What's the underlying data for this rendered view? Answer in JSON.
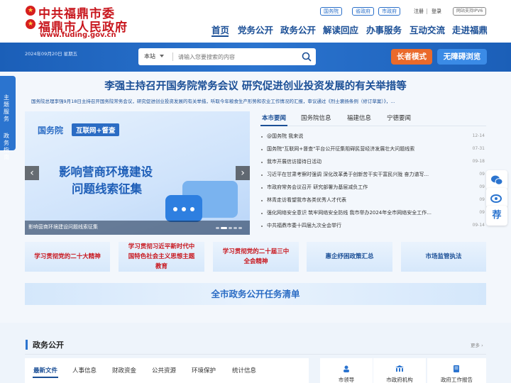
{
  "header": {
    "logo_line1": "中共福鼎市委",
    "logo_line2": "福鼎市人民政府",
    "logo_url": "www.fuding.gov.cn",
    "top_links": [
      "国务院",
      "省政府",
      "市政府"
    ],
    "register": "注册",
    "login": "登录",
    "ipv6": "网站支持IPV6"
  },
  "nav": [
    "首页",
    "党务公开",
    "政务公开",
    "解读回应",
    "办事服务",
    "互动交流",
    "走进福鼎"
  ],
  "band": {
    "date": "2024年09月20日 星期五",
    "search_scope": "本站",
    "search_placeholder": "请输入您要搜索的内容",
    "elder_mode": "长者模式",
    "accessible": "无障碍浏览"
  },
  "side_tab": {
    "item1": "主题服务",
    "item2": "政务指南"
  },
  "float_icons": [
    "wechat-icon",
    "weibo-icon",
    "recommend-icon"
  ],
  "float_recommend": "荐",
  "headline": {
    "title": "李强主持召开国务院常务会议 研究促进创业投资发展的有关举措等",
    "summary": "国务院总理李强9月18日主持召开国务院常务会议，研究促进创业投资发展的有关举措，听取今年粮食生产形势和农业工作情况的汇报，审议通过《烈士褒扬条例（修订草案）》，..."
  },
  "carousel": {
    "tag1": "国务院",
    "tag2": "互联网+督查",
    "title_line1": "影响营商环境建设",
    "title_line2": "问题线索征集",
    "caption": "影响营商环境建设问题线索征集",
    "prev": "‹",
    "next": "›"
  },
  "news": {
    "tabs": [
      "本市要闻",
      "国务院信息",
      "福建信息",
      "宁德要闻"
    ],
    "items": [
      {
        "title": "@国务院 我来说",
        "date": "12-14"
      },
      {
        "title": "国务院\"互联网+督查\"平台公开征集阻碍民营经济发展壮大问题线索",
        "date": "07-31"
      },
      {
        "title": "我市开展信访接待日活动",
        "date": "09-18"
      },
      {
        "title": "习近平在甘肃考察时强调 深化改革勇于创新苦干实干富民兴陇 奋力谱写...",
        "date": "09"
      },
      {
        "title": "市政府常务会议召开 研究部署为基层减负工作",
        "date": "09"
      },
      {
        "title": "林青走访看望我市各类优秀人才代表",
        "date": "09"
      },
      {
        "title": "强化网络安全意识 筑牢网络安全防线 我市举办2024年全市网络安全工作...",
        "date": "09"
      },
      {
        "title": "中共福鼎市委十四届九次全会举行",
        "date": "09-14"
      }
    ]
  },
  "features": [
    {
      "line1": "学习贯彻党的二十大精神",
      "line2": "",
      "line3": ""
    },
    {
      "line1": "学习贯彻习近平新时代中",
      "line2": "国特色社会主义思想主题",
      "line3": "教育"
    },
    {
      "line1": "学习贯彻党的二十届三中",
      "line2": "全会精神",
      "line3": ""
    },
    {
      "line1": "惠企纾困政策汇总",
      "line2": "",
      "line3": ""
    },
    {
      "line1": "市场监管执法",
      "line2": "",
      "line3": ""
    }
  ],
  "task_list": "全市政务公开任务清单",
  "gov_affairs": {
    "title": "政务公开",
    "more": "更多 ›",
    "tabs": [
      "最新文件",
      "人事信息",
      "财政资金",
      "公共资源",
      "环境保护",
      "统计信息"
    ],
    "cards": [
      "市领导",
      "市政府机构",
      "政府工作报告"
    ]
  },
  "colors": {
    "brand_red": "#c8161d",
    "nav_blue": "#1b4f96",
    "band_blue": "#2b74cf",
    "elder_orange": "#ea6a2b",
    "access_blue": "#3b8be6"
  }
}
